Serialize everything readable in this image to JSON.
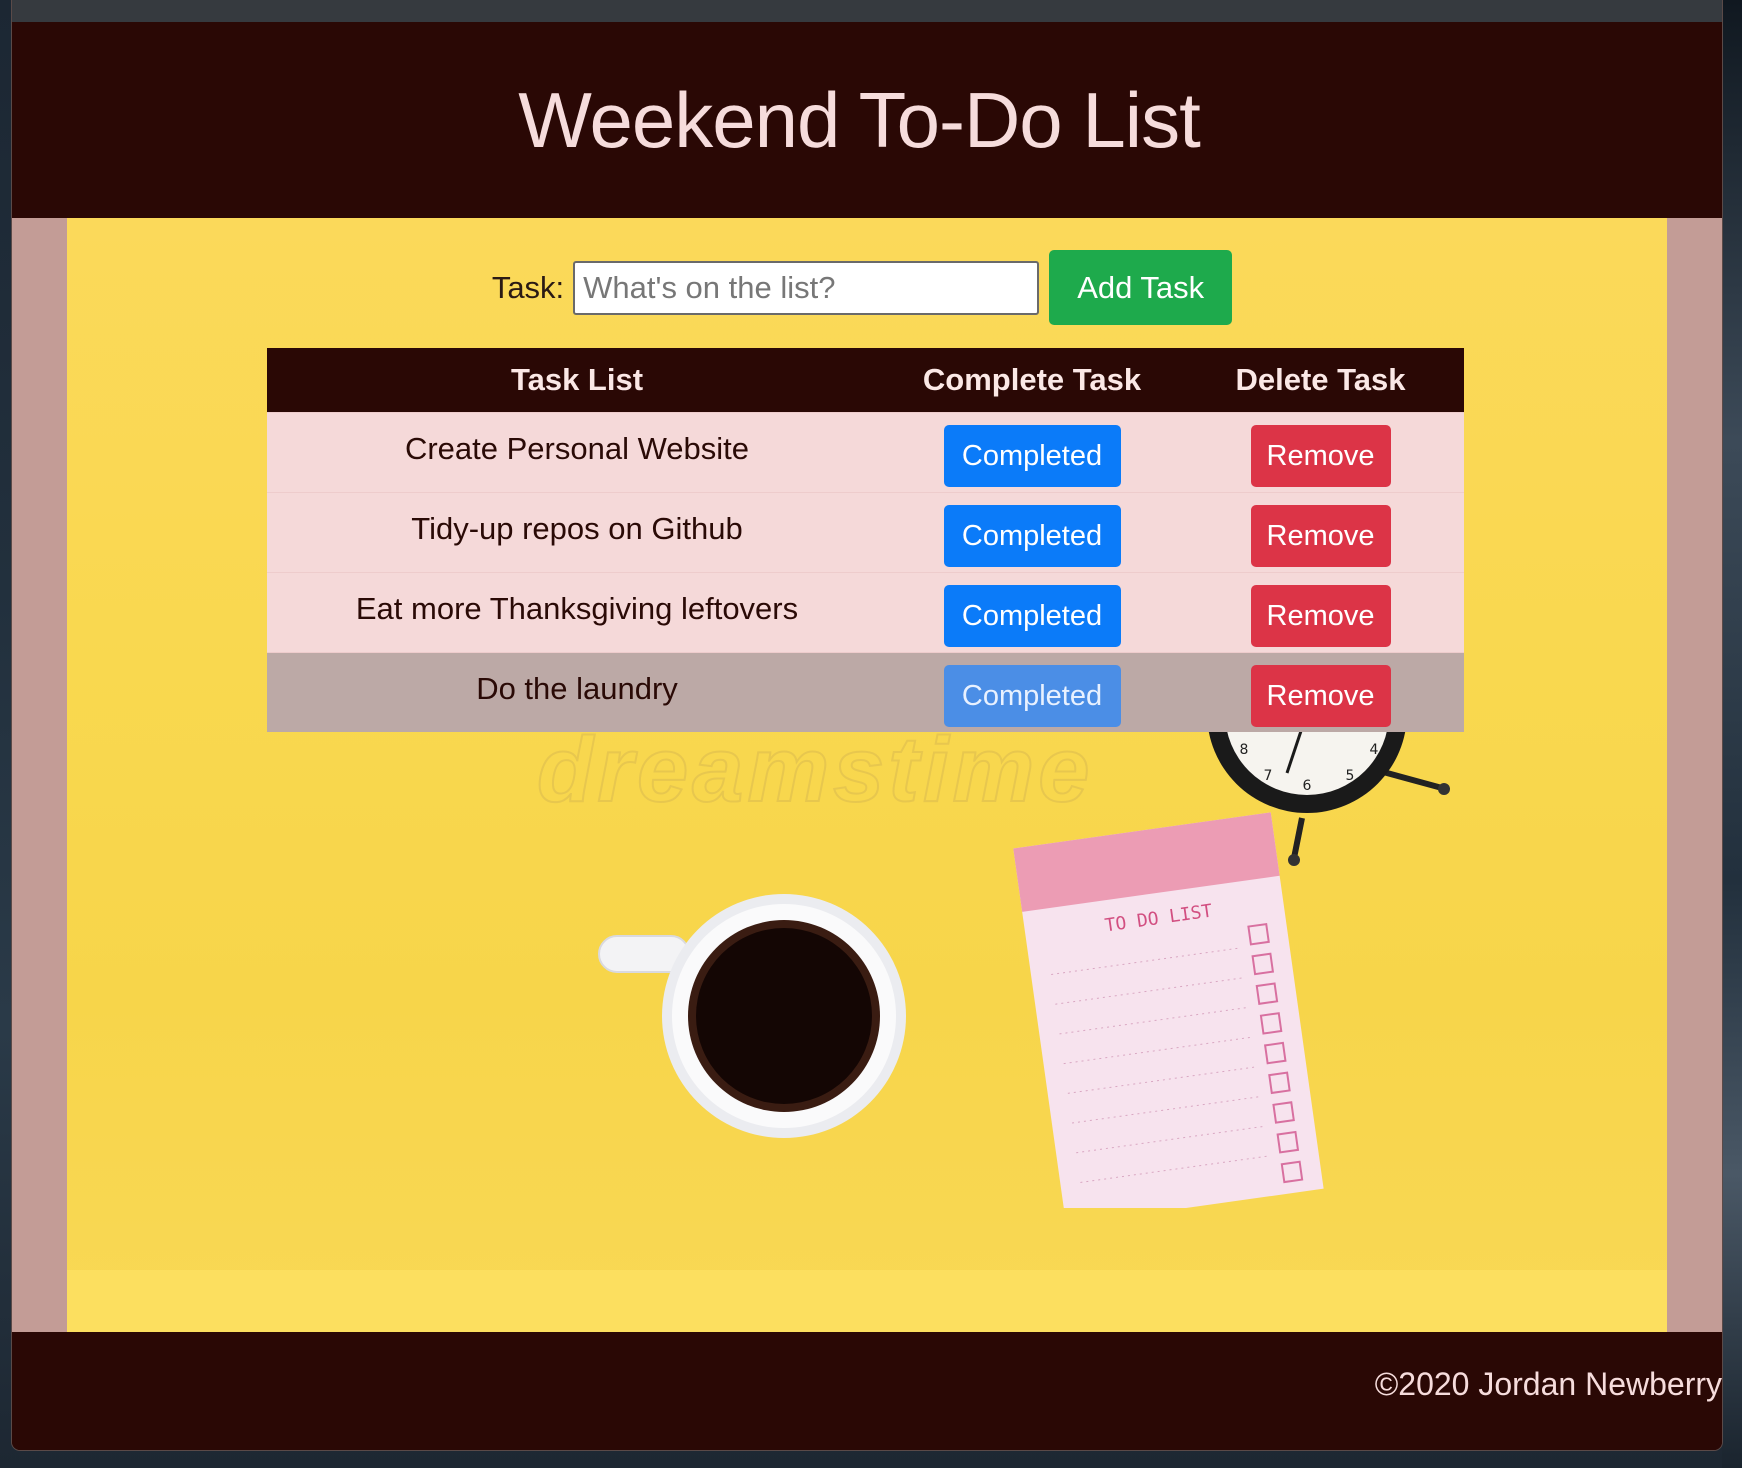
{
  "header": {
    "title": "Weekend To-Do List"
  },
  "form": {
    "label": "Task:",
    "placeholder": "What's on the list?",
    "value": "",
    "add_button": "Add Task"
  },
  "table": {
    "headers": [
      "Task List",
      "Complete Task",
      "Delete Task"
    ],
    "rows": [
      {
        "task": "Create Personal Website",
        "complete": "Completed",
        "delete": "Remove"
      },
      {
        "task": "Tidy-up repos on Github",
        "complete": "Completed",
        "delete": "Remove"
      },
      {
        "task": "Eat more Thanksgiving leftovers",
        "complete": "Completed",
        "delete": "Remove"
      },
      {
        "task": "Do the laundry",
        "complete": "Completed",
        "delete": "Remove"
      }
    ]
  },
  "background_image": {
    "watermark": "dreamstime",
    "notepad_title": "TO DO LIST",
    "icons": [
      "alarm-clock-icon",
      "coffee-cup-icon",
      "notepad-icon"
    ]
  },
  "footer": {
    "copyright": "©2020 Jordan Newberry"
  },
  "colors": {
    "header_bg": "#2a0805",
    "title": "#f6dcdc",
    "stage_bg": "#f9d84f",
    "add_button": "#1eaa4c",
    "complete_button": "#0b7bf9",
    "remove_button": "#dc3447",
    "row_bg": "#f5d9d9",
    "row_hover_bg": "#bca9a6"
  }
}
